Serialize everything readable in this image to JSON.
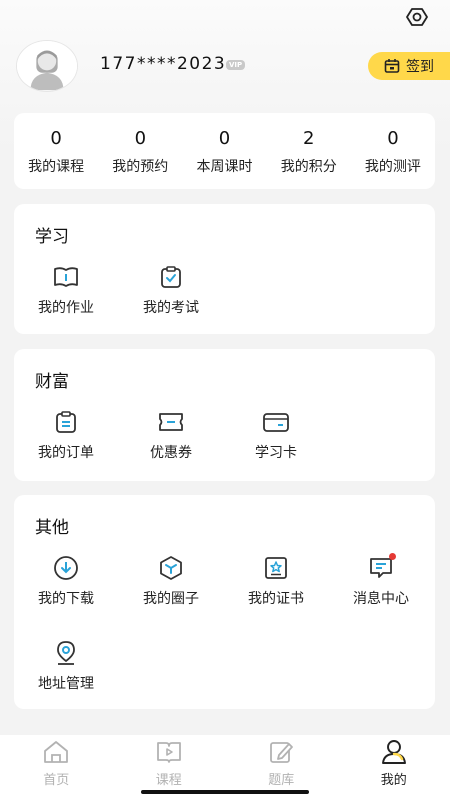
{
  "profile": {
    "phone": "177****2023",
    "vip_badge": "VIP",
    "checkin_label": "签到"
  },
  "stats": [
    {
      "value": "0",
      "label": "我的课程"
    },
    {
      "value": "0",
      "label": "我的预约"
    },
    {
      "value": "0",
      "label": "本周课时"
    },
    {
      "value": "2",
      "label": "我的积分"
    },
    {
      "value": "0",
      "label": "我的测评"
    }
  ],
  "study": {
    "title": "学习",
    "items": [
      {
        "label": "我的作业",
        "icon": "book-icon"
      },
      {
        "label": "我的考试",
        "icon": "clipboard-check-icon"
      }
    ]
  },
  "wealth": {
    "title": "财富",
    "items": [
      {
        "label": "我的订单",
        "icon": "order-icon"
      },
      {
        "label": "优惠券",
        "icon": "coupon-icon"
      },
      {
        "label": "学习卡",
        "icon": "card-icon"
      }
    ]
  },
  "other": {
    "title": "其他",
    "items": [
      {
        "label": "我的下载",
        "icon": "download-icon"
      },
      {
        "label": "我的圈子",
        "icon": "circle-icon"
      },
      {
        "label": "我的证书",
        "icon": "certificate-icon"
      },
      {
        "label": "消息中心",
        "icon": "message-icon",
        "has_notification_dot": true
      },
      {
        "label": "地址管理",
        "icon": "location-icon"
      }
    ]
  },
  "tabbar": {
    "items": [
      {
        "label": "首页",
        "icon": "home-icon",
        "active": false
      },
      {
        "label": "课程",
        "icon": "play-book-icon",
        "active": false
      },
      {
        "label": "题库",
        "icon": "edit-icon",
        "active": false
      },
      {
        "label": "我的",
        "icon": "user-icon",
        "active": true
      }
    ]
  },
  "colors": {
    "accent_yellow": "#ffd84a",
    "icon_blue": "#2aa3d8",
    "icon_dark": "#333333",
    "tab_inactive": "#b2b2b2",
    "notification_red": "#e53935"
  }
}
